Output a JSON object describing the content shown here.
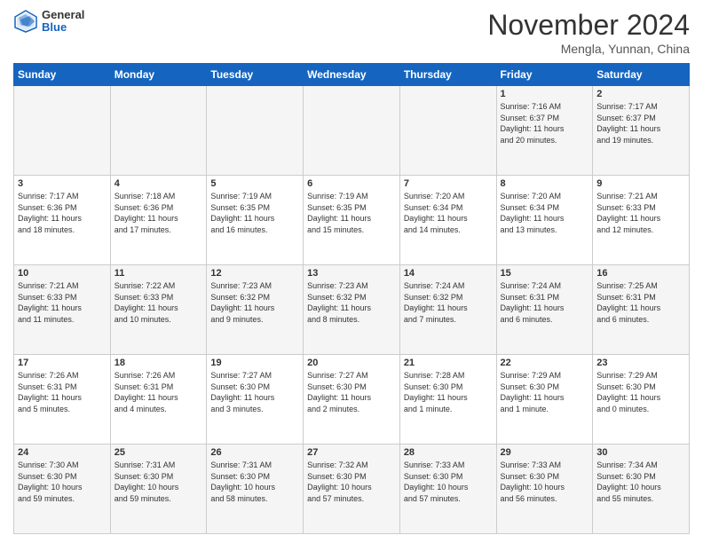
{
  "header": {
    "logo": {
      "general": "General",
      "blue": "Blue"
    },
    "title": "November 2024",
    "location": "Mengla, Yunnan, China"
  },
  "calendar": {
    "days_of_week": [
      "Sunday",
      "Monday",
      "Tuesday",
      "Wednesday",
      "Thursday",
      "Friday",
      "Saturday"
    ],
    "weeks": [
      [
        {
          "day": "",
          "info": ""
        },
        {
          "day": "",
          "info": ""
        },
        {
          "day": "",
          "info": ""
        },
        {
          "day": "",
          "info": ""
        },
        {
          "day": "",
          "info": ""
        },
        {
          "day": "1",
          "info": "Sunrise: 7:16 AM\nSunset: 6:37 PM\nDaylight: 11 hours\nand 20 minutes."
        },
        {
          "day": "2",
          "info": "Sunrise: 7:17 AM\nSunset: 6:37 PM\nDaylight: 11 hours\nand 19 minutes."
        }
      ],
      [
        {
          "day": "3",
          "info": "Sunrise: 7:17 AM\nSunset: 6:36 PM\nDaylight: 11 hours\nand 18 minutes."
        },
        {
          "day": "4",
          "info": "Sunrise: 7:18 AM\nSunset: 6:36 PM\nDaylight: 11 hours\nand 17 minutes."
        },
        {
          "day": "5",
          "info": "Sunrise: 7:19 AM\nSunset: 6:35 PM\nDaylight: 11 hours\nand 16 minutes."
        },
        {
          "day": "6",
          "info": "Sunrise: 7:19 AM\nSunset: 6:35 PM\nDaylight: 11 hours\nand 15 minutes."
        },
        {
          "day": "7",
          "info": "Sunrise: 7:20 AM\nSunset: 6:34 PM\nDaylight: 11 hours\nand 14 minutes."
        },
        {
          "day": "8",
          "info": "Sunrise: 7:20 AM\nSunset: 6:34 PM\nDaylight: 11 hours\nand 13 minutes."
        },
        {
          "day": "9",
          "info": "Sunrise: 7:21 AM\nSunset: 6:33 PM\nDaylight: 11 hours\nand 12 minutes."
        }
      ],
      [
        {
          "day": "10",
          "info": "Sunrise: 7:21 AM\nSunset: 6:33 PM\nDaylight: 11 hours\nand 11 minutes."
        },
        {
          "day": "11",
          "info": "Sunrise: 7:22 AM\nSunset: 6:33 PM\nDaylight: 11 hours\nand 10 minutes."
        },
        {
          "day": "12",
          "info": "Sunrise: 7:23 AM\nSunset: 6:32 PM\nDaylight: 11 hours\nand 9 minutes."
        },
        {
          "day": "13",
          "info": "Sunrise: 7:23 AM\nSunset: 6:32 PM\nDaylight: 11 hours\nand 8 minutes."
        },
        {
          "day": "14",
          "info": "Sunrise: 7:24 AM\nSunset: 6:32 PM\nDaylight: 11 hours\nand 7 minutes."
        },
        {
          "day": "15",
          "info": "Sunrise: 7:24 AM\nSunset: 6:31 PM\nDaylight: 11 hours\nand 6 minutes."
        },
        {
          "day": "16",
          "info": "Sunrise: 7:25 AM\nSunset: 6:31 PM\nDaylight: 11 hours\nand 6 minutes."
        }
      ],
      [
        {
          "day": "17",
          "info": "Sunrise: 7:26 AM\nSunset: 6:31 PM\nDaylight: 11 hours\nand 5 minutes."
        },
        {
          "day": "18",
          "info": "Sunrise: 7:26 AM\nSunset: 6:31 PM\nDaylight: 11 hours\nand 4 minutes."
        },
        {
          "day": "19",
          "info": "Sunrise: 7:27 AM\nSunset: 6:30 PM\nDaylight: 11 hours\nand 3 minutes."
        },
        {
          "day": "20",
          "info": "Sunrise: 7:27 AM\nSunset: 6:30 PM\nDaylight: 11 hours\nand 2 minutes."
        },
        {
          "day": "21",
          "info": "Sunrise: 7:28 AM\nSunset: 6:30 PM\nDaylight: 11 hours\nand 1 minute."
        },
        {
          "day": "22",
          "info": "Sunrise: 7:29 AM\nSunset: 6:30 PM\nDaylight: 11 hours\nand 1 minute."
        },
        {
          "day": "23",
          "info": "Sunrise: 7:29 AM\nSunset: 6:30 PM\nDaylight: 11 hours\nand 0 minutes."
        }
      ],
      [
        {
          "day": "24",
          "info": "Sunrise: 7:30 AM\nSunset: 6:30 PM\nDaylight: 10 hours\nand 59 minutes."
        },
        {
          "day": "25",
          "info": "Sunrise: 7:31 AM\nSunset: 6:30 PM\nDaylight: 10 hours\nand 59 minutes."
        },
        {
          "day": "26",
          "info": "Sunrise: 7:31 AM\nSunset: 6:30 PM\nDaylight: 10 hours\nand 58 minutes."
        },
        {
          "day": "27",
          "info": "Sunrise: 7:32 AM\nSunset: 6:30 PM\nDaylight: 10 hours\nand 57 minutes."
        },
        {
          "day": "28",
          "info": "Sunrise: 7:33 AM\nSunset: 6:30 PM\nDaylight: 10 hours\nand 57 minutes."
        },
        {
          "day": "29",
          "info": "Sunrise: 7:33 AM\nSunset: 6:30 PM\nDaylight: 10 hours\nand 56 minutes."
        },
        {
          "day": "30",
          "info": "Sunrise: 7:34 AM\nSunset: 6:30 PM\nDaylight: 10 hours\nand 55 minutes."
        }
      ]
    ]
  }
}
